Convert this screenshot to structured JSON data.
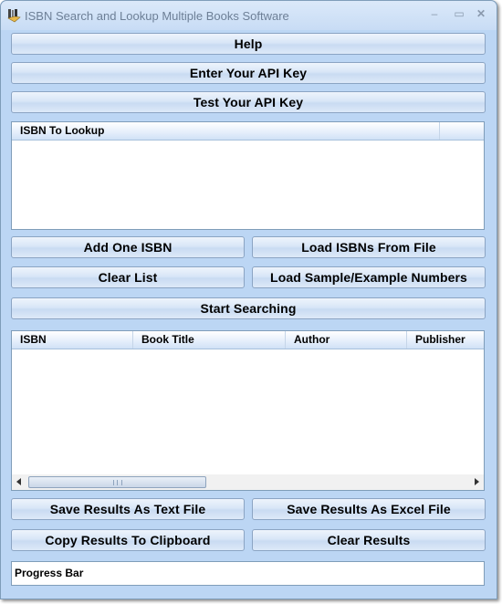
{
  "window": {
    "title": "ISBN Search and Lookup Multiple Books Software",
    "icon": "books-app-icon",
    "controls": {
      "minimize": "–",
      "maximize": "▭",
      "close": "✕"
    }
  },
  "toolbar": {
    "help_label": "Help",
    "enter_api_key_label": "Enter Your API Key",
    "test_api_key_label": "Test Your API Key"
  },
  "isbn_list": {
    "columns": [
      "ISBN To Lookup",
      ""
    ],
    "rows": []
  },
  "list_actions": {
    "add_one_label": "Add One ISBN",
    "load_file_label": "Load ISBNs From File",
    "clear_list_label": "Clear List",
    "load_sample_label": "Load Sample/Example Numbers",
    "start_label": "Start Searching"
  },
  "results": {
    "columns": [
      "ISBN",
      "Book Title",
      "Author",
      "Publisher"
    ],
    "rows": []
  },
  "result_actions": {
    "save_text_label": "Save Results As Text File",
    "save_excel_label": "Save Results As Excel File",
    "copy_label": "Copy Results To Clipboard",
    "clear_label": "Clear Results"
  },
  "status": {
    "progress_label": "Progress Bar"
  }
}
